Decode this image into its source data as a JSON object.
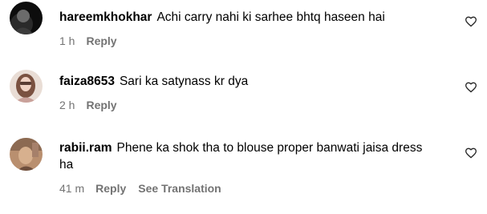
{
  "comments": [
    {
      "username": "hareemkhokhar",
      "text": "Achi carry nahi ki sarhee bhtq haseen hai",
      "time": "1 h",
      "reply_label": "Reply",
      "avatar_icon": "user-avatar",
      "like_icon": "heart-outline-icon"
    },
    {
      "username": "faiza8653",
      "text": "Sari ka satynass kr dya",
      "time": "2 h",
      "reply_label": "Reply",
      "avatar_icon": "user-avatar",
      "like_icon": "heart-outline-icon"
    },
    {
      "username": "rabii.ram",
      "text": "Phene ka shok tha to blouse proper banwati jaisa dress ha",
      "time": "41 m",
      "reply_label": "Reply",
      "see_translation_label": "See Translation",
      "avatar_icon": "user-avatar",
      "like_icon": "heart-outline-icon"
    }
  ],
  "colors": {
    "text": "#000000",
    "meta": "#737373",
    "background": "#ffffff"
  }
}
